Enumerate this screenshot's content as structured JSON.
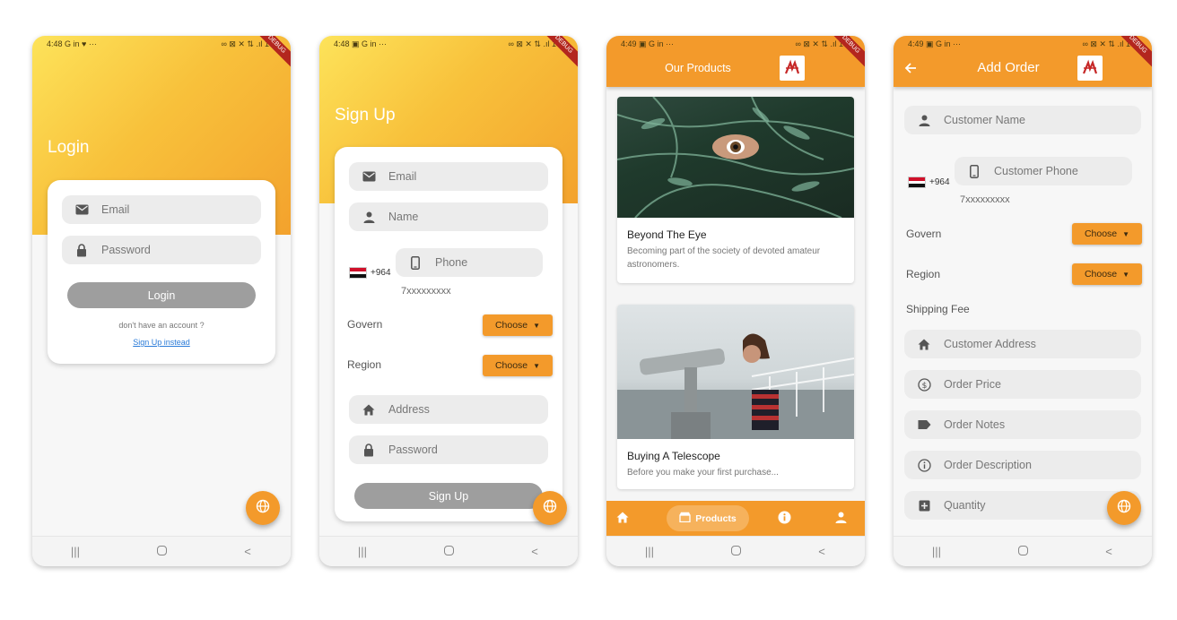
{
  "screen1": {
    "status_time": "4:48",
    "status_left_icons": "G in ♥ ···",
    "status_right": "∞ ⊠ ✕ ⇅ .ıl 100",
    "debug_banner": "DEBUG",
    "title": "Login",
    "email_placeholder": "Email",
    "password_placeholder": "Password",
    "login_label": "Login",
    "no_account_text": "don't have an account ?",
    "signup_link": "Sign Up instead"
  },
  "screen2": {
    "status_time": "4:48",
    "status_left_icons": "▣ G in ···",
    "status_right": "∞ ⊠ ✕ ⇅ .ıl 100",
    "debug_banner": "DEBUG",
    "title": "Sign Up",
    "email_placeholder": "Email",
    "name_placeholder": "Name",
    "country_code": "+964",
    "phone_placeholder": "Phone",
    "phone_hint": "7xxxxxxxxx",
    "govern_label": "Govern",
    "govern_choose": "Choose",
    "region_label": "Region",
    "region_choose": "Choose",
    "address_placeholder": "Address",
    "password_placeholder": "Password",
    "signup_label": "Sign Up"
  },
  "screen3": {
    "status_time": "4:49",
    "status_left_icons": "▣ G in ···",
    "status_right": "∞ ⊠ ✕ ⇅ .ıl 100",
    "debug_banner": "DEBUG",
    "title": "Our Products",
    "cards": [
      {
        "title": "Beyond The Eye",
        "desc": "Becoming part of the society of devoted amateur astronomers."
      },
      {
        "title": "Buying A Telescope",
        "desc": "Before you make your first purchase..."
      }
    ],
    "nav_products_label": "Products"
  },
  "screen4": {
    "status_time": "4:49",
    "status_left_icons": "▣ G in ···",
    "status_right": "∞ ⊠ ✕ ⇅ .ıl 100",
    "debug_banner": "DEBUG",
    "title": "Add Order",
    "customer_name": "Customer Name",
    "country_code": "+964",
    "customer_phone": "Customer Phone",
    "phone_hint": "7xxxxxxxxx",
    "govern_label": "Govern",
    "govern_choose": "Choose",
    "region_label": "Region",
    "region_choose": "Choose",
    "shipping_fee": "Shipping Fee",
    "customer_address": "Customer Address",
    "order_price": "Order Price",
    "order_notes": "Order Notes",
    "order_description": "Order Description",
    "quantity": "Quantity"
  },
  "colors": {
    "accent": "#f39a2b",
    "gradient_start": "#fde35a",
    "gradient_end": "#f3a22d",
    "button_gray": "#9e9e9e",
    "link_blue": "#2a7bd8"
  }
}
